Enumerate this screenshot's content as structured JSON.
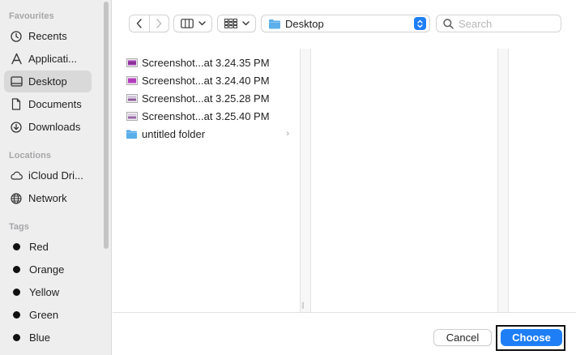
{
  "sidebar": {
    "favourites_heading": "Favourites",
    "favourites": [
      {
        "label": "Recents",
        "icon": "clock-icon"
      },
      {
        "label": "Applicati...",
        "icon": "applications-icon"
      },
      {
        "label": "Desktop",
        "icon": "desktop-icon",
        "selected": true
      },
      {
        "label": "Documents",
        "icon": "document-icon"
      },
      {
        "label": "Downloads",
        "icon": "download-icon"
      }
    ],
    "locations_heading": "Locations",
    "locations": [
      {
        "label": "iCloud Dri...",
        "icon": "cloud-icon"
      },
      {
        "label": "Network",
        "icon": "globe-icon"
      }
    ],
    "tags_heading": "Tags",
    "tags": [
      {
        "label": "Red"
      },
      {
        "label": "Orange"
      },
      {
        "label": "Yellow"
      },
      {
        "label": "Green"
      },
      {
        "label": "Blue"
      }
    ]
  },
  "toolbar": {
    "location": "Desktop",
    "search_placeholder": "Search"
  },
  "files": [
    {
      "name": "Screenshot...at 3.24.35 PM",
      "kind": "screenshot"
    },
    {
      "name": "Screenshot...at 3.24.40 PM",
      "kind": "screenshot"
    },
    {
      "name": "Screenshot...at 3.25.28 PM",
      "kind": "screenshot"
    },
    {
      "name": "Screenshot...at 3.25.40 PM",
      "kind": "screenshot"
    },
    {
      "name": "untitled folder",
      "kind": "folder"
    }
  ],
  "footer": {
    "cancel_label": "Cancel",
    "choose_label": "Choose"
  },
  "colors": {
    "accent": "#1e7ef5",
    "folder": "#5aaeea",
    "sidebar_bg": "#eeeeef"
  }
}
